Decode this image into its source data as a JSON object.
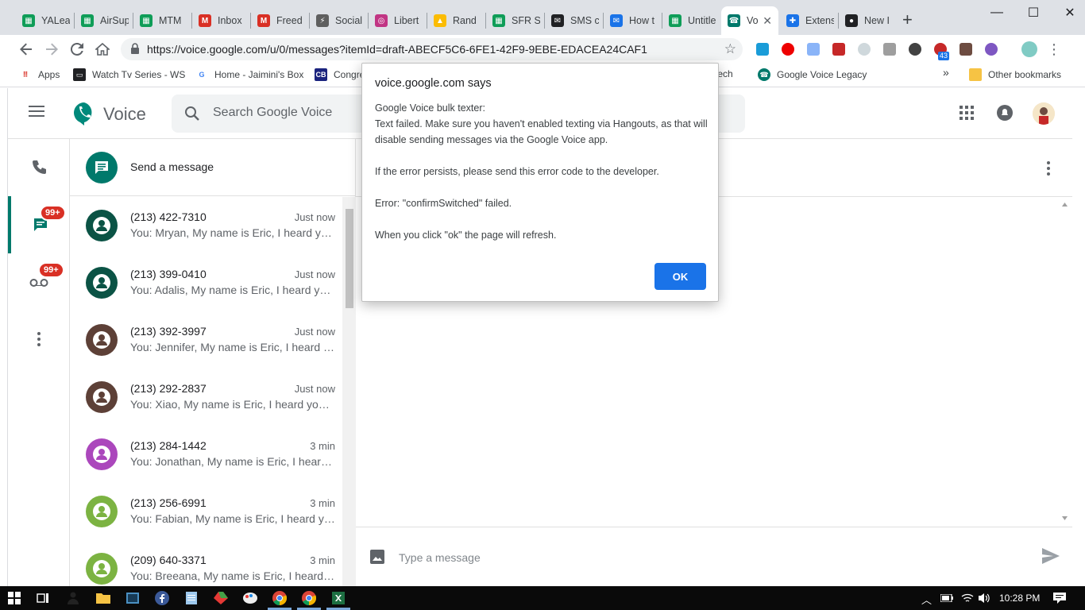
{
  "browser": {
    "tabs": [
      {
        "label": "YALea",
        "icon": "sheets-icon",
        "color": "#0f9d58"
      },
      {
        "label": "AirSup",
        "icon": "sheets-icon",
        "color": "#0f9d58"
      },
      {
        "label": "MTM",
        "icon": "sheets-icon",
        "color": "#0f9d58"
      },
      {
        "label": "Inbox",
        "icon": "gmail-icon",
        "color": "#d93025"
      },
      {
        "label": "Freed",
        "icon": "gmail-icon",
        "color": "#d93025"
      },
      {
        "label": "Social",
        "icon": "bolt-icon",
        "color": "#5f5f5f"
      },
      {
        "label": "Libert",
        "icon": "instagram-icon",
        "color": "#c13584"
      },
      {
        "label": "Rand",
        "icon": "drive-icon",
        "color": "#fbbc04"
      },
      {
        "label": "SFR Si",
        "icon": "sheets-icon",
        "color": "#0f9d58"
      },
      {
        "label": "SMS c",
        "icon": "mail-icon",
        "color": "#202124"
      },
      {
        "label": "How t",
        "icon": "mail-check-icon",
        "color": "#1a73e8"
      },
      {
        "label": "Untitle",
        "icon": "sheets-icon",
        "color": "#0f9d58"
      },
      {
        "label": "Vo",
        "icon": "voice-icon",
        "color": "#00796b",
        "active": true
      },
      {
        "label": "Extens",
        "icon": "puzzle-icon",
        "color": "#1a73e8"
      },
      {
        "label": "New I",
        "icon": "github-icon",
        "color": "#202124"
      }
    ],
    "url": "https://voice.google.com/u/0/messages?itemId=draft-ABECF5C6-6FE1-42F9-9EBE-EDACEA24CAF1",
    "bookmarks": [
      {
        "label": "Apps",
        "icon": "apps-grid-icon"
      },
      {
        "label": "Watch Tv Series - WS",
        "icon": "tv-icon"
      },
      {
        "label": "Home - Jaimini's Box",
        "icon": "google-icon"
      },
      {
        "label": "Congre",
        "icon": "cb-icon"
      },
      {
        "label": "eriech",
        "icon": ""
      },
      {
        "label": "Google Voice Legacy",
        "icon": "voice-icon"
      }
    ],
    "bookmarks_more": "»",
    "other_bookmarks": "Other bookmarks",
    "ext_badge": "43"
  },
  "voice": {
    "app_name": "Voice",
    "search_placeholder": "Search Google Voice",
    "badges": {
      "messages": "99+",
      "voicemail": "99+"
    },
    "send_message_label": "Send a message",
    "conversations": [
      {
        "number": "(213) 422-7310",
        "time": "Just now",
        "preview": "You: Mryan, My name is Eric, I heard you're looking to sell your property",
        "color": "#0b5345"
      },
      {
        "number": "(213) 399-0410",
        "time": "Just now",
        "preview": "You: Adalis, My name is Eric, I heard you're looking to sell your property",
        "color": "#0b5345"
      },
      {
        "number": "(213) 392-3997",
        "time": "Just now",
        "preview": "You: Jennifer, My name is Eric, I heard you're looking to sell your property",
        "color": "#5d4037"
      },
      {
        "number": "(213) 292-2837",
        "time": "Just now",
        "preview": "You: Xiao, My name is Eric, I heard you're looking to sell your property",
        "color": "#5d4037"
      },
      {
        "number": "(213) 284-1442",
        "time": "3 min",
        "preview": "You: Jonathan, My name is Eric, I heard you're looking to sell your property",
        "color": "#ab47bc"
      },
      {
        "number": "(213) 256-6991",
        "time": "3 min",
        "preview": "You: Fabian, My name is Eric, I heard you're looking to sell your property",
        "color": "#7cb342"
      },
      {
        "number": "(209) 640-3371",
        "time": "3 min",
        "preview": "You: Breeana, My name is Eric, I heard you're looking to sell your property",
        "color": "#7cb342"
      }
    ],
    "composer_placeholder": "Type a message"
  },
  "dialog": {
    "title": "voice.google.com says",
    "lines": [
      "Google Voice bulk texter:",
      "Text failed. Make sure you haven't enabled texting via Hangouts, as that will disable sending messages via the Google Voice app.",
      "",
      "If the error persists, please send this error code to the developer.",
      "",
      "Error: \"confirmSwitched\" failed.",
      "",
      "When you click \"ok\" the page will refresh."
    ],
    "ok_label": "OK"
  },
  "taskbar": {
    "clock": "10:28 PM"
  },
  "colors": {
    "accent": "#00796b",
    "badge": "#d93025",
    "ok_button": "#1a73e8"
  }
}
